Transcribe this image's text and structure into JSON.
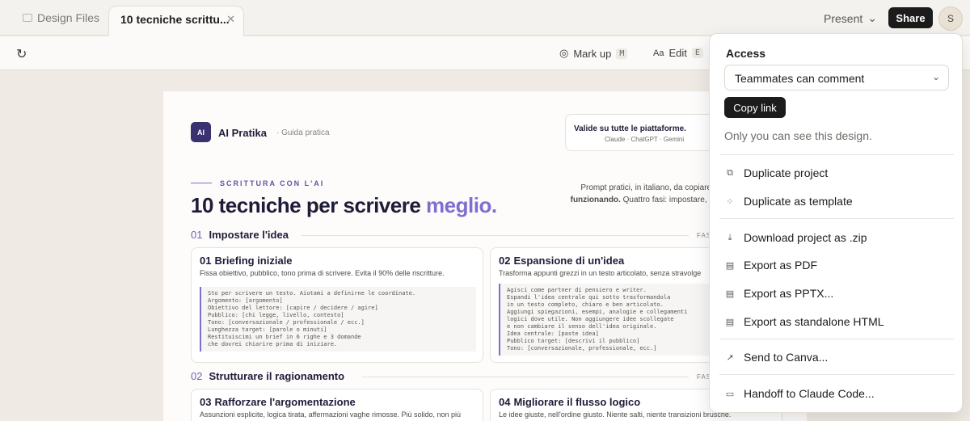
{
  "tabs": {
    "files_label": "Design Files",
    "active_label": "10 tecniche scrittu...",
    "close_glyph": "✕"
  },
  "header": {
    "present_label": "Present",
    "share_label": "Share",
    "avatar_initial": "S"
  },
  "toolbar": {
    "markup_label": "Mark up",
    "markup_key": "M",
    "edit_label": "Edit",
    "edit_key": "E"
  },
  "document": {
    "logo_text": "AI",
    "brand": "AI Pratika",
    "subtitle": "· Guida pratica",
    "platform_line1": "Valide su tutte le piattaforme.",
    "platform_line2": "Claude · ChatGPT · Gemini",
    "kicker": "SCRITTURA CON L'AI",
    "headline_main": "10 tecniche per scrivere ",
    "headline_accent": "meglio.",
    "intro_line1": "Prompt pratici, in italiano, da copiare qu",
    "intro_line2_bold": "funzionando.",
    "intro_line2_rest": " Quattro fasi: impostare, stru",
    "sections": [
      {
        "num": "01",
        "title": "Impostare l'idea",
        "fase": "FAS"
      },
      {
        "num": "02",
        "title": "Strutturare il ragionamento",
        "fase": "FAS"
      }
    ],
    "cards": [
      {
        "num": "01",
        "title": "Briefing iniziale",
        "desc": "Fissa obiettivo, pubblico, tono prima di scrivere. Evita il 90% delle riscritture.",
        "code": "Sto per scrivere un testo. Aiutami a definirne le coordinate.\nArgomento: [argomento]\nObiettivo del lettore: [capire / decidere / agire]\nPubblico: [chi legge, livello, contesto]\nTono: [conversazionale / professionale / ecc.]\nLunghezza target: [parole o minuti]\nRestituiscimi un brief in 6 righe e 3 domande\nche dovrei chiarire prima di iniziare."
      },
      {
        "num": "02",
        "title": "Espansione di un'idea",
        "desc": "Trasforma appunti grezzi in un testo articolato, senza stravolge",
        "code": "Agisci come partner di pensiero e writer.\nEspandi l'idea centrale qui sotto trasformandola\nin un testo completo, chiaro e ben articolato.\nAggiungi spiegazioni, esempi, analogie e collegamenti\nlogici dove utile. Non aggiungere idee scollegate\ne non cambiare il senso dell'idea originale.\nIdea centrale: [paste idea]\nPubblico target: [descrivi il pubblico]\nTono: [conversazionale, professionale, ecc.]"
      },
      {
        "num": "03",
        "title": "Rafforzare l'argomentazione",
        "desc": "Assunzioni esplicite, logica tirata, affermazioni vaghe rimosse. Più solido, non più"
      },
      {
        "num": "04",
        "title": "Migliorare il flusso logico",
        "desc": "Le idee giuste, nell'ordine giusto. Niente salti, niente transizioni brusche."
      }
    ]
  },
  "share_panel": {
    "access_label": "Access",
    "access_value": "Teammates can comment",
    "copy_link_label": "Copy link",
    "visibility_note": "Only you can see this design.",
    "items": [
      {
        "label": "Duplicate project",
        "icon": "duplicate-icon"
      },
      {
        "label": "Duplicate as template",
        "icon": "template-icon"
      },
      {
        "label": "Download project as .zip",
        "icon": "download-icon"
      },
      {
        "label": "Export as PDF",
        "icon": "file-icon"
      },
      {
        "label": "Export as PPTX...",
        "icon": "file-icon"
      },
      {
        "label": "Export as standalone HTML",
        "icon": "file-icon"
      },
      {
        "label": "Send to Canva...",
        "icon": "external-link-icon"
      },
      {
        "label": "Handoff to Claude Code...",
        "icon": "terminal-icon"
      }
    ]
  }
}
